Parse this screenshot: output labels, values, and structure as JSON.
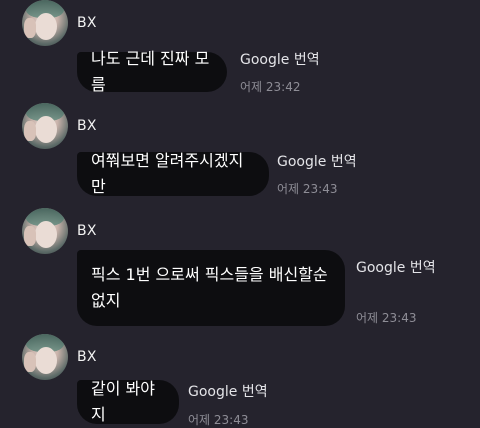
{
  "messages": [
    {
      "sender": "BX",
      "text": "나도 근데 진짜 모름",
      "translate_label": "Google 번역",
      "time": "어제 23:42"
    },
    {
      "sender": "BX",
      "text": "여쭤보면 알려주시겠지만",
      "translate_label": "Google 번역",
      "time": "어제 23:43"
    },
    {
      "sender": "BX",
      "text": "픽스 1번 으로써 픽스들을 배신할순없지",
      "translate_label": "Google 번역",
      "time": "어제 23:43"
    },
    {
      "sender": "BX",
      "text": "같이 봐야지",
      "translate_label": "Google 번역",
      "time": "어제 23:43"
    }
  ]
}
